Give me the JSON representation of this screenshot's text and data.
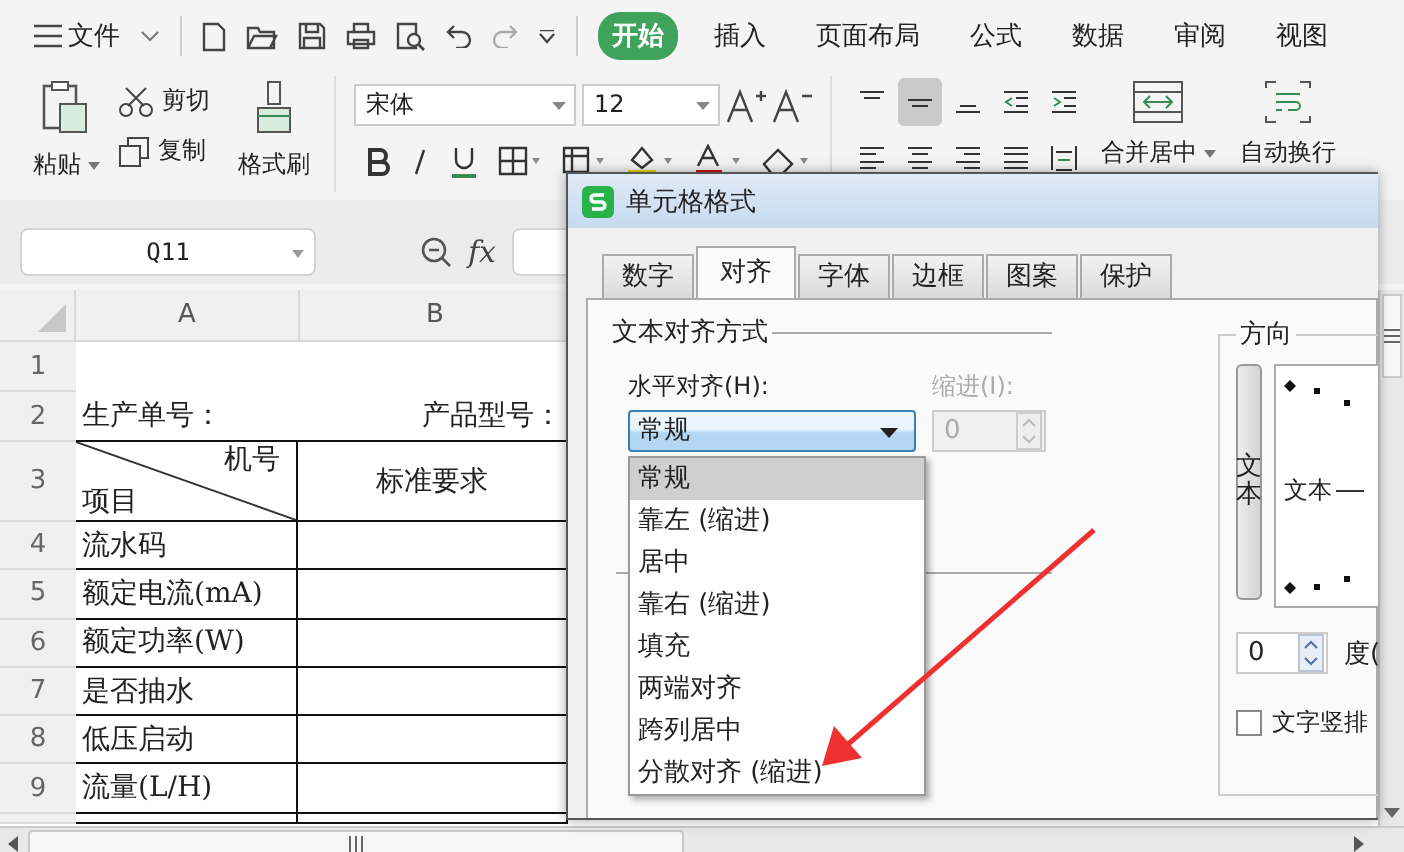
{
  "menu": {
    "label": "文件"
  },
  "ribbon_tabs": [
    {
      "label": "开始",
      "selected": true
    },
    {
      "label": "插入",
      "selected": false
    },
    {
      "label": "页面布局",
      "selected": false
    },
    {
      "label": "公式",
      "selected": false
    },
    {
      "label": "数据",
      "selected": false
    },
    {
      "label": "审阅",
      "selected": false
    },
    {
      "label": "视图",
      "selected": false
    }
  ],
  "ribbon": {
    "paste": "粘贴",
    "cut": "剪切",
    "copy": "复制",
    "format_painter": "格式刷",
    "font_name": "宋体",
    "font_size": "12",
    "merge": "合并居中",
    "wrap": "自动换行"
  },
  "align_buttons": [
    {
      "kind": "top",
      "selected": false
    },
    {
      "kind": "middle",
      "selected": true
    },
    {
      "kind": "bottom",
      "selected": false
    },
    {
      "kind": "outdent",
      "selected": false
    },
    {
      "kind": "indent",
      "selected": false
    },
    {
      "kind": "left",
      "selected": false
    },
    {
      "kind": "center",
      "selected": false
    },
    {
      "kind": "right",
      "selected": false
    },
    {
      "kind": "justify",
      "selected": false
    },
    {
      "kind": "distributed",
      "selected": false
    }
  ],
  "formula_bar": {
    "cell_ref": "Q11",
    "fx": "fx"
  },
  "sheet": {
    "columns": [
      "A",
      "B"
    ],
    "rows": [
      {
        "number": "1",
        "kind": "blank"
      },
      {
        "number": "2",
        "kind": "labels",
        "a": "生产单号：",
        "b": "产品型号："
      },
      {
        "number": "3",
        "kind": "diagonal",
        "a_top": "机号",
        "a_bottom": "项目",
        "b": "标准要求"
      },
      {
        "number": "4",
        "kind": "item",
        "a": "流水码"
      },
      {
        "number": "5",
        "kind": "item",
        "a": "额定电流(mA)"
      },
      {
        "number": "6",
        "kind": "item",
        "a": "额定功率(W)"
      },
      {
        "number": "7",
        "kind": "item",
        "a": "是否抽水"
      },
      {
        "number": "8",
        "kind": "item",
        "a": "低压启动"
      },
      {
        "number": "9",
        "kind": "item",
        "a": "流量(L/H)"
      }
    ]
  },
  "dialog": {
    "title": "单元格格式",
    "tabs": [
      {
        "label": "数字",
        "selected": false
      },
      {
        "label": "对齐",
        "selected": true
      },
      {
        "label": "字体",
        "selected": false
      },
      {
        "label": "边框",
        "selected": false
      },
      {
        "label": "图案",
        "selected": false
      },
      {
        "label": "保护",
        "selected": false
      }
    ],
    "text_alignment": {
      "title": "文本对齐方式",
      "horizontal_label": "水平对齐(H):",
      "horizontal_value": "常规",
      "indent_label": "缩进(I):",
      "indent_value": "0",
      "indent_disabled": true
    },
    "options": [
      {
        "label": "常规",
        "selected": true
      },
      {
        "label": "靠左 (缩进)",
        "selected": false
      },
      {
        "label": "居中",
        "selected": false
      },
      {
        "label": "靠右 (缩进)",
        "selected": false
      },
      {
        "label": "填充",
        "selected": false
      },
      {
        "label": "两端对齐",
        "selected": false
      },
      {
        "label": "跨列居中",
        "selected": false
      },
      {
        "label": "分散对齐 (缩进)",
        "selected": false
      }
    ],
    "orientation": {
      "title": "方向",
      "vertical_text": "文本",
      "preview_text": "文本",
      "degrees_value": "0",
      "degrees_label": "度(",
      "vertical_checkbox_label": "文字竖排",
      "vertical_checked": false
    }
  }
}
